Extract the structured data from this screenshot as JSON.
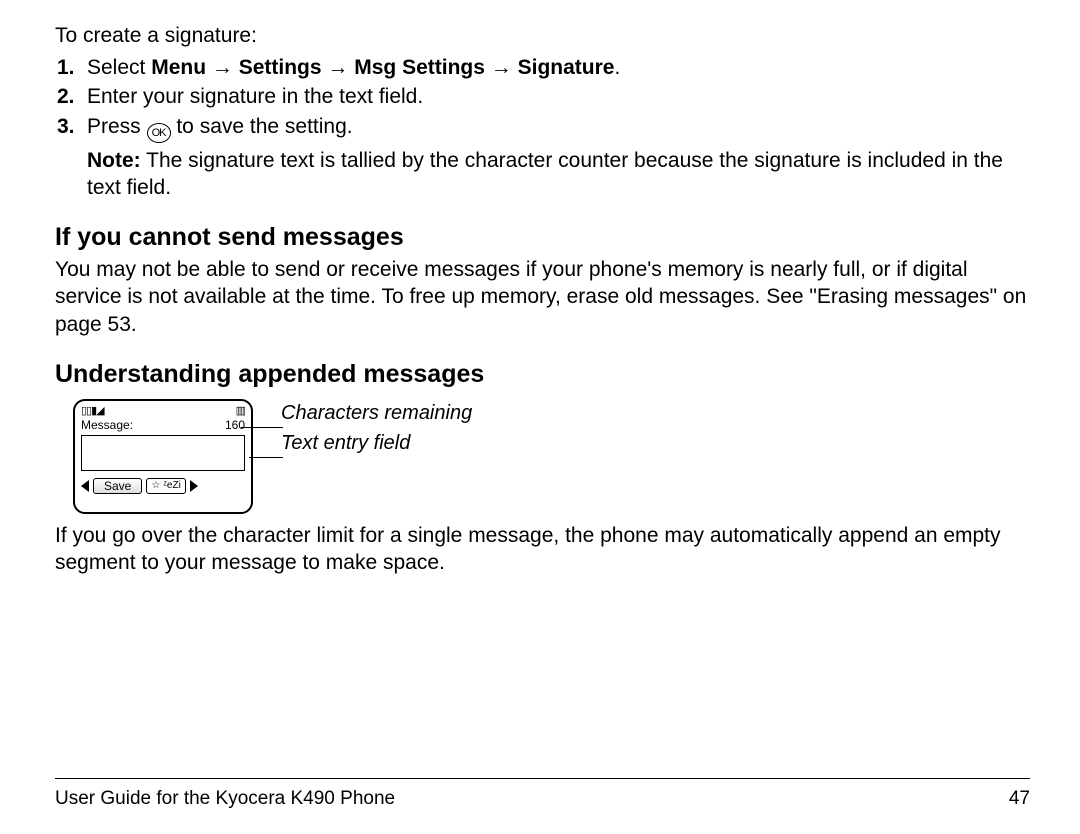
{
  "intro": "To create a signature:",
  "steps": {
    "num1": "1.",
    "num2": "2.",
    "num3": "3.",
    "s1_pre": "Select ",
    "s1_menu": "Menu",
    "s1_arrow": "→",
    "s1_settings": "Settings",
    "s1_msg": "Msg Settings",
    "s1_sig": "Signature",
    "s1_dot": ".",
    "s2": "Enter your signature in the text field.",
    "s3_pre": "Press ",
    "s3_ok": "OK",
    "s3_post": " to save the setting."
  },
  "note": {
    "label": "Note:",
    "body": "  The signature text is tallied by the character counter because the signature is included in the text field."
  },
  "sec1_title": "If you cannot send messages",
  "sec1_body": "You may not be able to send or receive messages if your phone's memory is nearly full, or if digital service is not available at the time. To free up memory, erase old messages. See \"Erasing messages\" on page 53.",
  "sec2_title": "Understanding appended messages",
  "phone": {
    "status_left": "▯▯▮◢",
    "status_right": "▥",
    "message_label": "Message:",
    "count": "160",
    "save": "Save",
    "mode1": "☆",
    "mode2": "ᶻeZi"
  },
  "callouts": {
    "chars": "Characters remaining",
    "textfield": "Text entry field"
  },
  "sec2_body": "If you go over the character limit for a single message, the phone may automatically append an empty segment to your message to make space.",
  "footer_title": "User Guide for the Kyocera K490 Phone",
  "footer_page": "47"
}
